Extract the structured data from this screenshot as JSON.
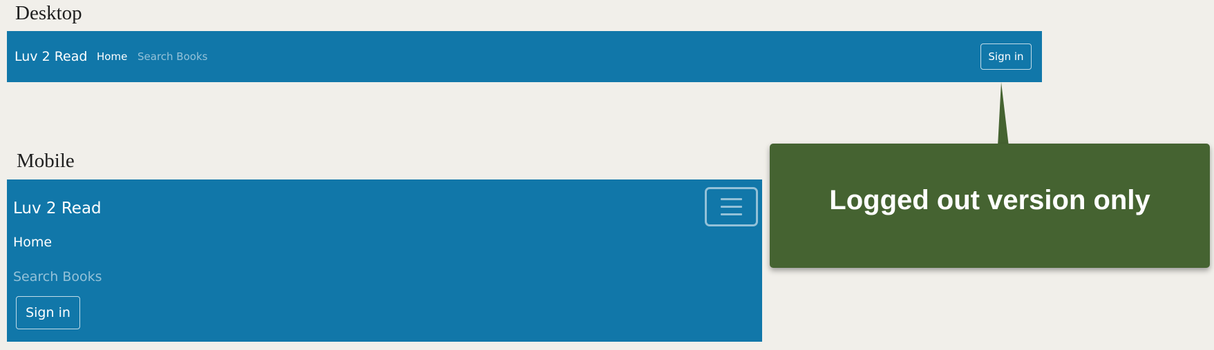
{
  "labels": {
    "desktop": "Desktop",
    "mobile": "Mobile"
  },
  "desktop_nav": {
    "brand": "Luv 2 Read",
    "links": [
      {
        "label": "Home",
        "active": true
      },
      {
        "label": "Search Books",
        "active": false
      }
    ],
    "signin_label": "Sign in"
  },
  "mobile_nav": {
    "brand": "Luv 2 Read",
    "links": [
      {
        "label": "Home",
        "active": true
      },
      {
        "label": "Search Books",
        "active": false
      }
    ],
    "signin_label": "Sign in",
    "toggler_icon": "hamburger-menu-icon"
  },
  "callout": {
    "text": "Logged out version only"
  },
  "colors": {
    "navbar": "#1177a9",
    "callout": "#456331",
    "background": "#f1efea"
  }
}
